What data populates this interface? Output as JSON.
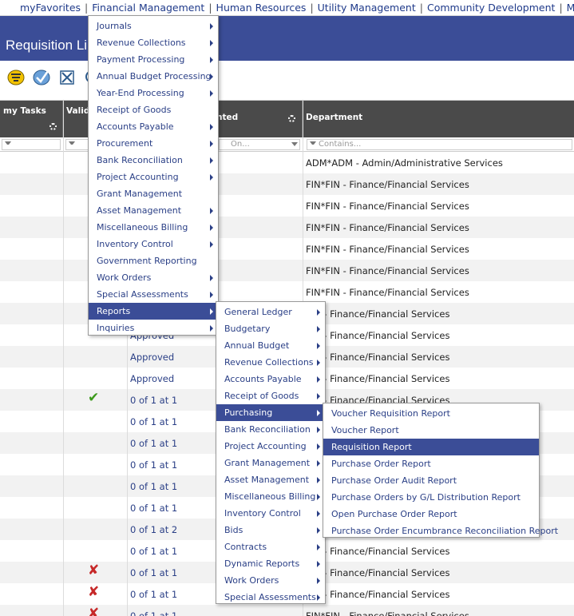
{
  "topnav": {
    "items": [
      "myFavorites",
      "Financial Management",
      "Human Resources",
      "Utility Management",
      "Community Development",
      "Maintena"
    ]
  },
  "page": {
    "title": "Requisition Li"
  },
  "grid": {
    "headers": {
      "tasks": "my Tasks",
      "valid": "Valida",
      "printed": "nted",
      "department": "Department"
    },
    "filters": {
      "printed": "On...",
      "department": "Contains..."
    },
    "rows": [
      {
        "status": "",
        "dept": "ADM*ADM - Admin/Administrative Services",
        "mark": ""
      },
      {
        "status": "",
        "dept": "FIN*FIN - Finance/Financial Services",
        "mark": ""
      },
      {
        "status": "",
        "dept": "FIN*FIN - Finance/Financial Services",
        "mark": ""
      },
      {
        "status": "",
        "dept": "FIN*FIN - Finance/Financial Services",
        "mark": ""
      },
      {
        "status": "",
        "dept": "FIN*FIN - Finance/Financial Services",
        "mark": ""
      },
      {
        "status": "",
        "dept": "FIN*FIN - Finance/Financial Services",
        "mark": ""
      },
      {
        "status": "",
        "dept": "FIN*FIN - Finance/Financial Services",
        "mark": ""
      },
      {
        "status": "",
        "dept": "FIN - Finance/Financial Services",
        "mark": ""
      },
      {
        "status": "Approved",
        "dept": "FIN - Finance/Financial Services",
        "mark": ""
      },
      {
        "status": "Approved",
        "dept": "FIN - Finance/Financial Services",
        "mark": ""
      },
      {
        "status": "Approved",
        "dept": "FIN - Finance/Financial Services",
        "mark": ""
      },
      {
        "status": "0 of 1 at 1",
        "dept": "FIN - Finance/Financial Services",
        "mark": "check"
      },
      {
        "status": "0 of 1 at 1",
        "dept": "",
        "mark": ""
      },
      {
        "status": "0 of 1 at 1",
        "dept": "",
        "mark": ""
      },
      {
        "status": "0 of 1 at 1",
        "dept": "",
        "mark": ""
      },
      {
        "status": "0 of 1 at 1",
        "dept": "",
        "mark": ""
      },
      {
        "status": "0 of 1 at 1",
        "dept": "",
        "mark": ""
      },
      {
        "status": "0 of 1 at 2",
        "dept": "",
        "mark": ""
      },
      {
        "status": "0 of 1 at 1",
        "dept": "FIN - Finance/Financial Services",
        "mark": ""
      },
      {
        "status": "0 of 1 at 1",
        "dept": "FIN - Finance/Financial Services",
        "mark": "cross"
      },
      {
        "status": "0 of 1 at 1",
        "dept": "FIN - Finance/Financial Services",
        "mark": "cross"
      },
      {
        "status": "0 of 1 at 1",
        "dept": "FIN*FIN - Finance/Financial Services",
        "mark": "cross"
      }
    ]
  },
  "menu1": {
    "items": [
      {
        "label": "Journals",
        "sub": true
      },
      {
        "label": "Revenue Collections",
        "sub": true
      },
      {
        "label": "Payment Processing",
        "sub": true
      },
      {
        "label": "Annual Budget Processing",
        "sub": true
      },
      {
        "label": "Year-End Processing",
        "sub": true
      },
      {
        "label": "Receipt of Goods",
        "sub": false
      },
      {
        "label": "Accounts Payable",
        "sub": true
      },
      {
        "label": "Procurement",
        "sub": true
      },
      {
        "label": "Bank Reconciliation",
        "sub": true
      },
      {
        "label": "Project Accounting",
        "sub": true
      },
      {
        "label": "Grant Management",
        "sub": false
      },
      {
        "label": "Asset Management",
        "sub": true
      },
      {
        "label": "Miscellaneous Billing",
        "sub": true
      },
      {
        "label": "Inventory Control",
        "sub": true
      },
      {
        "label": "Government Reporting",
        "sub": false
      },
      {
        "label": "Work Orders",
        "sub": true
      },
      {
        "label": "Special Assessments",
        "sub": true
      },
      {
        "label": "Reports",
        "sub": true
      },
      {
        "label": "Inquiries",
        "sub": true
      }
    ],
    "highlight": 17
  },
  "menu2": {
    "items": [
      {
        "label": "General Ledger",
        "sub": true
      },
      {
        "label": "Budgetary",
        "sub": true
      },
      {
        "label": "Annual Budget",
        "sub": true
      },
      {
        "label": "Revenue Collections",
        "sub": true
      },
      {
        "label": "Accounts Payable",
        "sub": true
      },
      {
        "label": "Receipt of Goods",
        "sub": true
      },
      {
        "label": "Purchasing",
        "sub": true
      },
      {
        "label": "Bank Reconciliation",
        "sub": true
      },
      {
        "label": "Project Accounting",
        "sub": true
      },
      {
        "label": "Grant Management",
        "sub": true
      },
      {
        "label": "Asset Management",
        "sub": true
      },
      {
        "label": "Miscellaneous Billing",
        "sub": true
      },
      {
        "label": "Inventory Control",
        "sub": true
      },
      {
        "label": "Bids",
        "sub": true
      },
      {
        "label": "Contracts",
        "sub": true
      },
      {
        "label": "Dynamic Reports",
        "sub": true
      },
      {
        "label": "Work Orders",
        "sub": true
      },
      {
        "label": "Special Assessments",
        "sub": true
      }
    ],
    "highlight": 6
  },
  "menu3": {
    "items": [
      {
        "label": "Voucher Requisition Report",
        "sub": false
      },
      {
        "label": "Voucher Report",
        "sub": false
      },
      {
        "label": "Requisition Report",
        "sub": false
      },
      {
        "label": "Purchase Order Report",
        "sub": false
      },
      {
        "label": "Purchase Order Audit Report",
        "sub": false
      },
      {
        "label": "Purchase Orders by G/L Distribution Report",
        "sub": false
      },
      {
        "label": "Open Purchase Order Report",
        "sub": false
      },
      {
        "label": "Purchase Order Encumbrance Reconciliation Report",
        "sub": false
      }
    ],
    "highlight": 2
  },
  "colors": {
    "accent": "#3b4d97",
    "link": "#2a3f86",
    "header": "#4a4a4a"
  }
}
